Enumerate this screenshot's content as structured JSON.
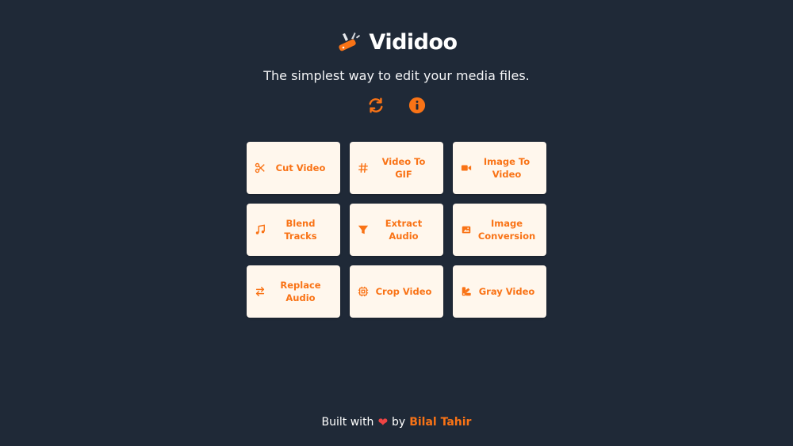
{
  "brand": {
    "name": "Vididoo",
    "logo_icon": "swiss-knife-icon"
  },
  "tagline": "The simplest way to edit your media files.",
  "header_icons": [
    {
      "name": "refresh-icon"
    },
    {
      "name": "info-icon"
    }
  ],
  "tools": [
    {
      "label": "Cut Video",
      "icon": "scissors-icon"
    },
    {
      "label": "Video To GIF",
      "icon": "hashtag-icon"
    },
    {
      "label": "Image To Video",
      "icon": "video-camera-icon"
    },
    {
      "label": "Blend Tracks",
      "icon": "music-note-icon"
    },
    {
      "label": "Extract Audio",
      "icon": "filter-icon"
    },
    {
      "label": "Image Conversion",
      "icon": "image-icon"
    },
    {
      "label": "Replace Audio",
      "icon": "swap-arrows-icon"
    },
    {
      "label": "Crop Video",
      "icon": "crop-chip-icon"
    },
    {
      "label": "Gray Video",
      "icon": "color-swatch-icon"
    }
  ],
  "footer": {
    "prefix": "Built with",
    "connector": "by",
    "author": "Bilal Tahir",
    "heart_icon": "heart-icon"
  },
  "colors": {
    "background": "#1f2937",
    "accent": "#f97316",
    "card": "#fff7ed",
    "heart": "#ef4444"
  }
}
